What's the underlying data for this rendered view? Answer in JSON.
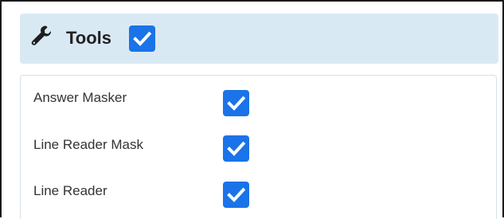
{
  "header": {
    "icon": "wrench-icon",
    "title": "Tools",
    "enabled": true
  },
  "options": [
    {
      "label": "Answer Masker",
      "checked": true
    },
    {
      "label": "Line Reader Mask",
      "checked": true
    },
    {
      "label": "Line Reader",
      "checked": true
    }
  ],
  "colors": {
    "header_bg": "#d9e9f4",
    "checkbox_accent": "#1a73e8",
    "frame_border": "#1a1a1a",
    "options_border": "#d4e1ea"
  }
}
